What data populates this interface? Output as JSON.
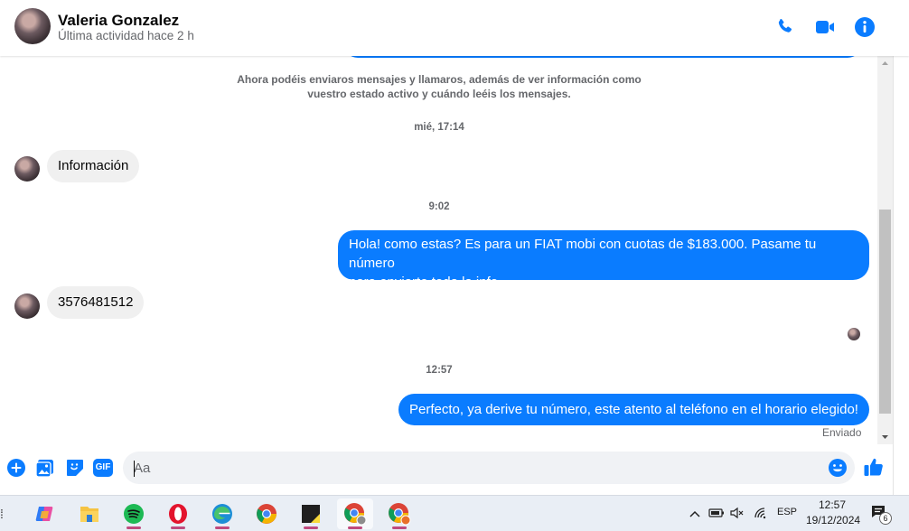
{
  "header": {
    "name": "Valeria Gonzalez",
    "status": "Última actividad hace 2 h",
    "icons": [
      "phone-icon",
      "video-icon",
      "info-icon"
    ],
    "accent": "#0a7cff"
  },
  "chat": {
    "system_notice_line1": "Ahora podéis enviaros mensajes y llamaros, además de ver información como",
    "system_notice_line2": "vuestro estado activo y cuándo leéis los mensajes.",
    "timestamps": [
      "mié, 17:14",
      "9:02",
      "12:57"
    ],
    "messages": [
      {
        "from": "contact",
        "text": "Información"
      },
      {
        "from": "me",
        "line1": "Hola! como estas? Es para un FIAT mobi con cuotas de $183.000. Pasame tu número",
        "line2": "para enviarte toda la info"
      },
      {
        "from": "contact",
        "text": "3576481512"
      },
      {
        "from": "me",
        "text": "Perfecto, ya derive tu número, este atento al teléfono en el horario elegido!"
      }
    ],
    "sent_status": "Enviado"
  },
  "composer": {
    "placeholder": "Aa",
    "icons": [
      "plus-icon",
      "image-icon",
      "sticker-icon",
      "gif-icon",
      "emoji-icon",
      "like-icon"
    ],
    "gif_label": "GIF"
  },
  "taskbar": {
    "apps": [
      "copilot-icon",
      "file-explorer-icon",
      "spotify-icon",
      "opera-icon",
      "edge-icon",
      "chrome-icon",
      "sticky-notes-icon",
      "chrome-profile-icon",
      "chrome-profile-2-icon"
    ],
    "language": "ESP",
    "time": "12:57",
    "date": "19/12/2024",
    "notification_count": "6"
  }
}
